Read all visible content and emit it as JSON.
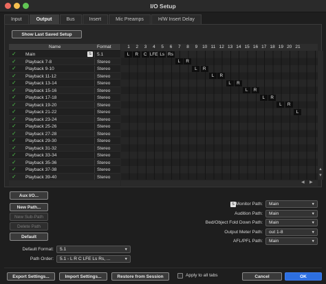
{
  "window": {
    "title": "I/O Setup"
  },
  "tabs": [
    "Input",
    "Output",
    "Bus",
    "Insert",
    "Mic Preamps",
    "H/W Insert Delay"
  ],
  "active_tab": "Output",
  "show_last_saved_label": "Show Last Saved Setup",
  "table": {
    "col_name": "Name",
    "col_format": "Format",
    "channel_numbers": [
      "1",
      "2",
      "3",
      "4",
      "5",
      "6",
      "7",
      "8",
      "9",
      "10",
      "11",
      "12",
      "13",
      "14",
      "15",
      "16",
      "17",
      "18",
      "19",
      "20",
      "21"
    ],
    "rows": [
      {
        "name": "Main",
        "format": "5.1",
        "icon": "S"
      },
      {
        "name": "Playback 7-8",
        "format": "Stereo"
      },
      {
        "name": "Playback 9-10",
        "format": "Stereo"
      },
      {
        "name": "Playback 11-12",
        "format": "Stereo"
      },
      {
        "name": "Playback 13-14",
        "format": "Stereo"
      },
      {
        "name": "Playback 15-16",
        "format": "Stereo"
      },
      {
        "name": "Playback 17-18",
        "format": "Stereo"
      },
      {
        "name": "Playback 19-20",
        "format": "Stereo"
      },
      {
        "name": "Playback 21-22",
        "format": "Stereo"
      },
      {
        "name": "Playback 23-24",
        "format": "Stereo"
      },
      {
        "name": "Playback 25-26",
        "format": "Stereo"
      },
      {
        "name": "Playback 27-28",
        "format": "Stereo"
      },
      {
        "name": "Playback 29-30",
        "format": "Stereo"
      },
      {
        "name": "Playback 31-32",
        "format": "Stereo"
      },
      {
        "name": "Playback 33-34",
        "format": "Stereo"
      },
      {
        "name": "Playback 35-36",
        "format": "Stereo"
      },
      {
        "name": "Playback 37-38",
        "format": "Stereo"
      },
      {
        "name": "Playback 39-40",
        "format": "Stereo"
      }
    ],
    "assignments": [
      {
        "row": 0,
        "cols": [
          1,
          2,
          3,
          4,
          5,
          6
        ],
        "labels": [
          "L",
          "R",
          "C",
          "LFE",
          "Ls",
          "Rs"
        ]
      },
      {
        "row": 1,
        "cols": [
          7,
          8
        ],
        "labels": [
          "L",
          "R"
        ]
      },
      {
        "row": 2,
        "cols": [
          9,
          10
        ],
        "labels": [
          "L",
          "R"
        ]
      },
      {
        "row": 3,
        "cols": [
          11,
          12
        ],
        "labels": [
          "L",
          "R"
        ]
      },
      {
        "row": 4,
        "cols": [
          13,
          14
        ],
        "labels": [
          "L",
          "R"
        ]
      },
      {
        "row": 5,
        "cols": [
          15,
          16
        ],
        "labels": [
          "L",
          "R"
        ]
      },
      {
        "row": 6,
        "cols": [
          17,
          18
        ],
        "labels": [
          "L",
          "R"
        ]
      },
      {
        "row": 7,
        "cols": [
          19,
          20
        ],
        "labels": [
          "L",
          "R"
        ]
      },
      {
        "row": 8,
        "cols": [
          21
        ],
        "labels": [
          "L"
        ]
      }
    ]
  },
  "left_buttons": {
    "aux_io": "Aux I/O...",
    "new_path": "New Path...",
    "new_sub_path": "New Sub-Path",
    "delete_path": "Delete Path",
    "default": "Default"
  },
  "default_format": {
    "label": "Default Format:",
    "value": "5.1"
  },
  "path_order": {
    "label": "Path Order:",
    "value": "5.1 - L R C LFE Ls Rs, ..."
  },
  "right_settings": [
    {
      "label": "Monitor Path:",
      "value": "Main"
    },
    {
      "label": "Audition Path:",
      "value": "Main"
    },
    {
      "label": "Bed/Object Fold Down Path:",
      "value": "Main"
    },
    {
      "label": "Output Meter Path:",
      "value": "out 1-8"
    },
    {
      "label": "AFL/PFL Path:",
      "value": "Main"
    }
  ],
  "monitor_icon": "S",
  "footer": {
    "export": "Export Settings...",
    "import": "Import Settings...",
    "restore": "Restore from Session",
    "apply_all": "Apply to all tabs",
    "cancel": "Cancel",
    "ok": "OK"
  },
  "colors": {
    "accent": "#2d6fe0",
    "check": "#4fc24a"
  }
}
